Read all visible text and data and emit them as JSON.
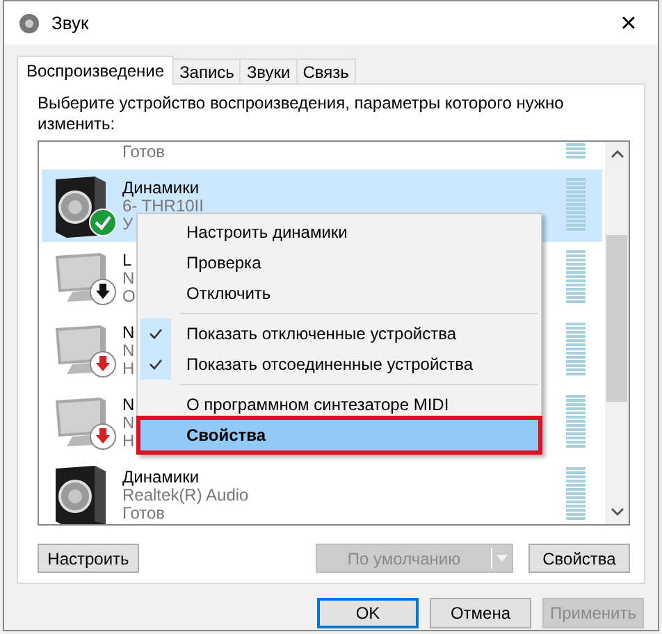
{
  "window": {
    "title": "Звук",
    "close": "×"
  },
  "tabs": [
    {
      "label": "Воспроизведение",
      "selected": true
    },
    {
      "label": "Запись",
      "selected": false
    },
    {
      "label": "Звуки",
      "selected": false
    },
    {
      "label": "Связь",
      "selected": false
    }
  ],
  "instruction": "Выберите устройство воспроизведения, параметры которого нужно изменить:",
  "devices": [
    {
      "kind": "other",
      "lines": [
        "Готов"
      ],
      "selected": false,
      "default": false,
      "disabled": false,
      "unplugged": false
    },
    {
      "kind": "speaker",
      "lines": [
        "Динамики",
        "6- THR10II",
        "У"
      ],
      "selected": true,
      "default": true,
      "disabled": false,
      "unplugged": false
    },
    {
      "kind": "monitor",
      "lines": [
        "L",
        "N",
        "O"
      ],
      "selected": false,
      "default": false,
      "disabled": true,
      "unplugged": false
    },
    {
      "kind": "monitor",
      "lines": [
        "N",
        "N",
        "H"
      ],
      "selected": false,
      "default": false,
      "disabled": false,
      "unplugged": true
    },
    {
      "kind": "monitor",
      "lines": [
        "N",
        "N",
        "H"
      ],
      "selected": false,
      "default": false,
      "disabled": false,
      "unplugged": true
    },
    {
      "kind": "speaker",
      "lines": [
        "Динамики",
        "Realtek(R) Audio",
        "Готов"
      ],
      "selected": false,
      "default": false,
      "disabled": false,
      "unplugged": false
    }
  ],
  "panel_buttons": [
    {
      "label": "Настроить",
      "disabled": false,
      "kind": "plain"
    },
    {
      "label": "По умолчанию",
      "disabled": true,
      "kind": "split"
    },
    {
      "label": "Свойства",
      "disabled": false,
      "kind": "plain"
    }
  ],
  "context_menu": [
    {
      "kind": "item",
      "label": "Настроить динамики",
      "checked": false,
      "bold": false,
      "highlighted": false,
      "outlined": false
    },
    {
      "kind": "item",
      "label": "Проверка",
      "checked": false,
      "bold": false,
      "highlighted": false,
      "outlined": false
    },
    {
      "kind": "item",
      "label": "Отключить",
      "checked": false,
      "bold": false,
      "highlighted": false,
      "outlined": false
    },
    {
      "kind": "separator"
    },
    {
      "kind": "item",
      "label": "Показать отключенные устройства",
      "checked": true,
      "bold": false,
      "highlighted": false,
      "outlined": false
    },
    {
      "kind": "item",
      "label": "Показать отсоединенные устройства",
      "checked": true,
      "bold": false,
      "highlighted": false,
      "outlined": false
    },
    {
      "kind": "separator"
    },
    {
      "kind": "item",
      "label": "О программном синтезаторе MIDI",
      "checked": false,
      "bold": false,
      "highlighted": false,
      "outlined": false
    },
    {
      "kind": "item",
      "label": "Свойства",
      "checked": false,
      "bold": true,
      "highlighted": true,
      "outlined": true
    }
  ],
  "dialog_buttons": [
    {
      "label": "OK",
      "disabled": false,
      "default": true
    },
    {
      "label": "Отмена",
      "disabled": false,
      "default": false
    },
    {
      "label": "Применить",
      "disabled": true,
      "default": false
    }
  ]
}
